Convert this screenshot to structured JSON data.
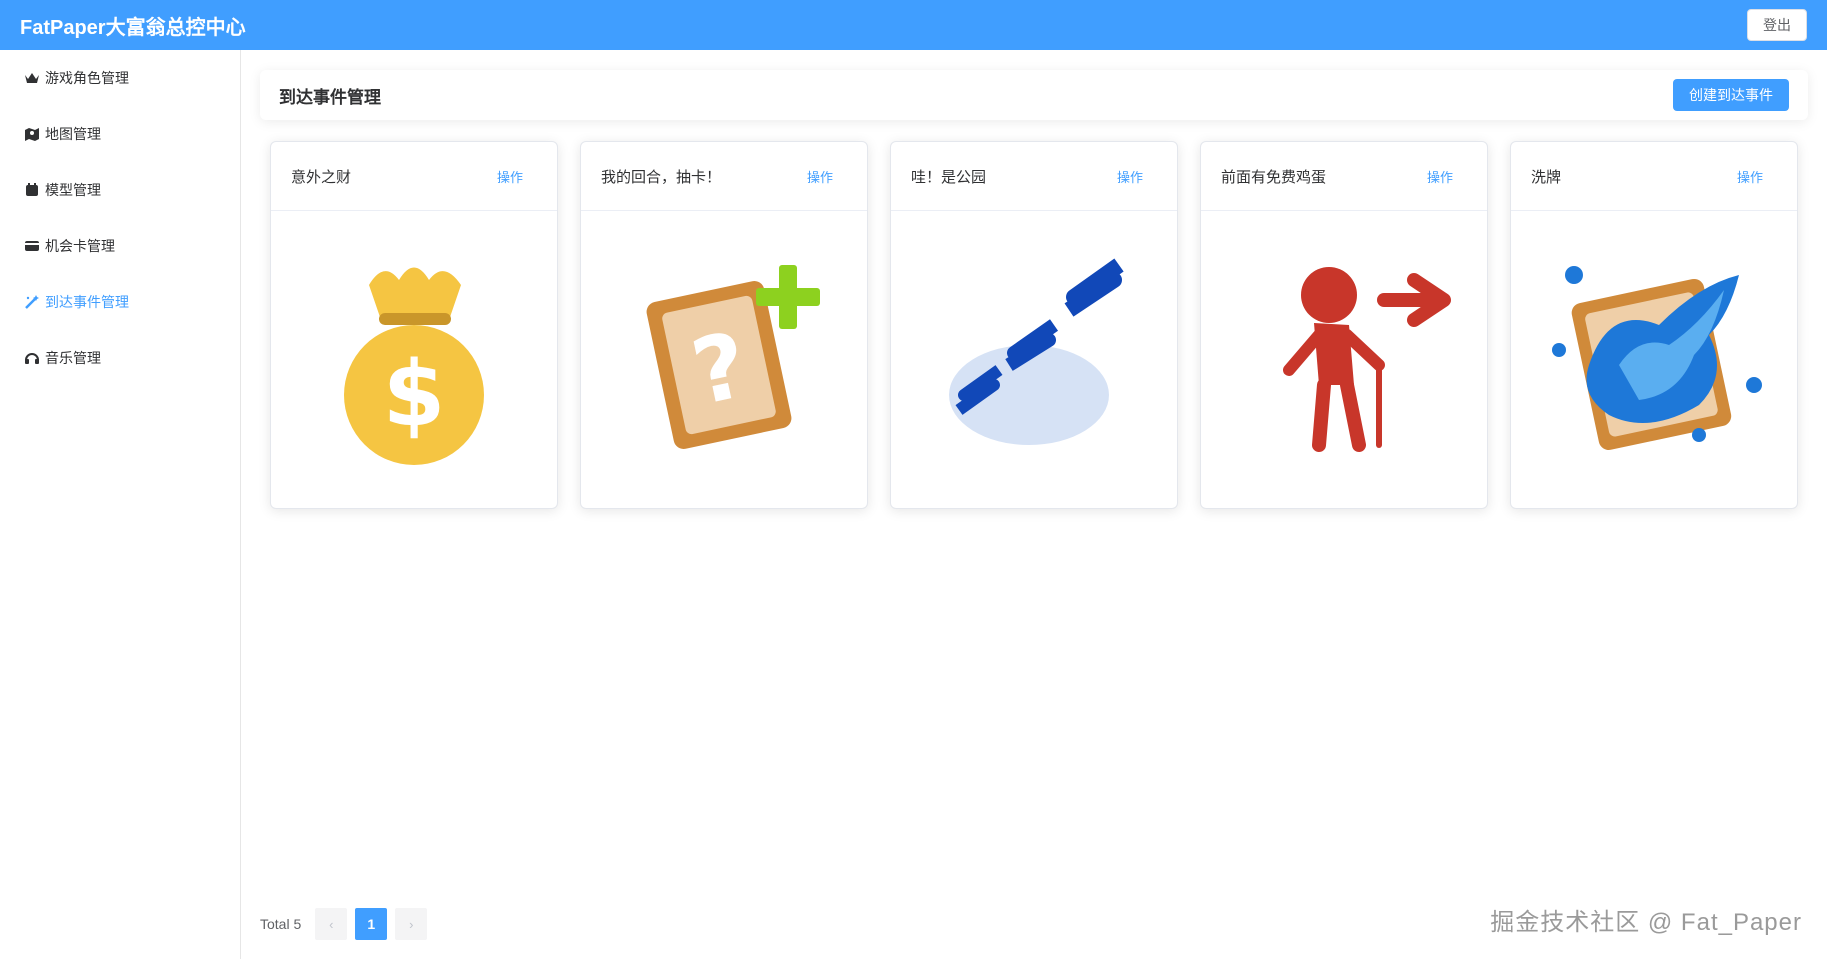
{
  "header": {
    "title": "FatPaper大富翁总控中心",
    "logout_label": "登出"
  },
  "sidebar": {
    "items": [
      {
        "label": "游戏角色管理",
        "icon": "crown-icon",
        "active": false
      },
      {
        "label": "地图管理",
        "icon": "map-icon",
        "active": false
      },
      {
        "label": "模型管理",
        "icon": "box-icon",
        "active": false
      },
      {
        "label": "机会卡管理",
        "icon": "card-icon",
        "active": false
      },
      {
        "label": "到达事件管理",
        "icon": "magic-wand-icon",
        "active": true
      },
      {
        "label": "音乐管理",
        "icon": "headphones-icon",
        "active": false
      }
    ]
  },
  "main": {
    "title": "到达事件管理",
    "create_label": "创建到达事件",
    "cards": [
      {
        "title": "意外之财",
        "op_label": "操作",
        "icon": "money-bag-icon"
      },
      {
        "title": "我的回合，抽卡！",
        "op_label": "操作",
        "icon": "mystery-card-plus-icon"
      },
      {
        "title": "哇！是公园",
        "op_label": "操作",
        "icon": "sleep-zzz-icon"
      },
      {
        "title": "前面有免费鸡蛋",
        "op_label": "操作",
        "icon": "old-man-arrow-icon"
      },
      {
        "title": "洗牌",
        "op_label": "操作",
        "icon": "card-splash-icon"
      }
    ]
  },
  "pagination": {
    "total_label": "Total 5",
    "prev": "‹",
    "current": "1",
    "next": "›"
  },
  "watermark": "掘金技术社区 @ Fat_Paper",
  "colors": {
    "primary": "#409eff",
    "header_bg": "#409eff"
  }
}
